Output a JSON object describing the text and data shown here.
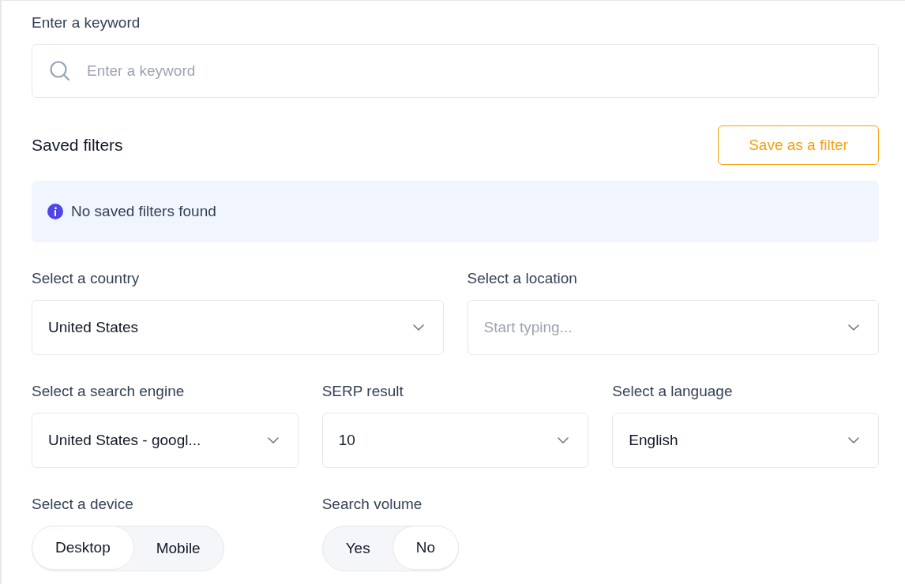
{
  "keyword": {
    "label": "Enter a keyword",
    "placeholder": "Enter a keyword"
  },
  "saved_filters": {
    "title": "Saved filters",
    "button": "Save as a filter",
    "notice": "No saved filters found"
  },
  "select_rows": [
    [
      {
        "label": "Select a country",
        "value": "United States"
      },
      {
        "label": "Select a location",
        "placeholder": "Start typing..."
      }
    ],
    [
      {
        "label": "Select a search engine",
        "value": "United States - googl..."
      },
      {
        "label": "SERP result",
        "value": "10"
      },
      {
        "label": "Select a language",
        "value": "English"
      }
    ]
  ],
  "toggles": [
    {
      "label": "Select a device",
      "options": [
        {
          "label": "Desktop",
          "selected": true
        },
        {
          "label": "Mobile",
          "selected": false
        }
      ]
    },
    {
      "label": "Search volume",
      "options": [
        {
          "label": "Yes",
          "selected": false
        },
        {
          "label": "No",
          "selected": true
        }
      ]
    }
  ]
}
